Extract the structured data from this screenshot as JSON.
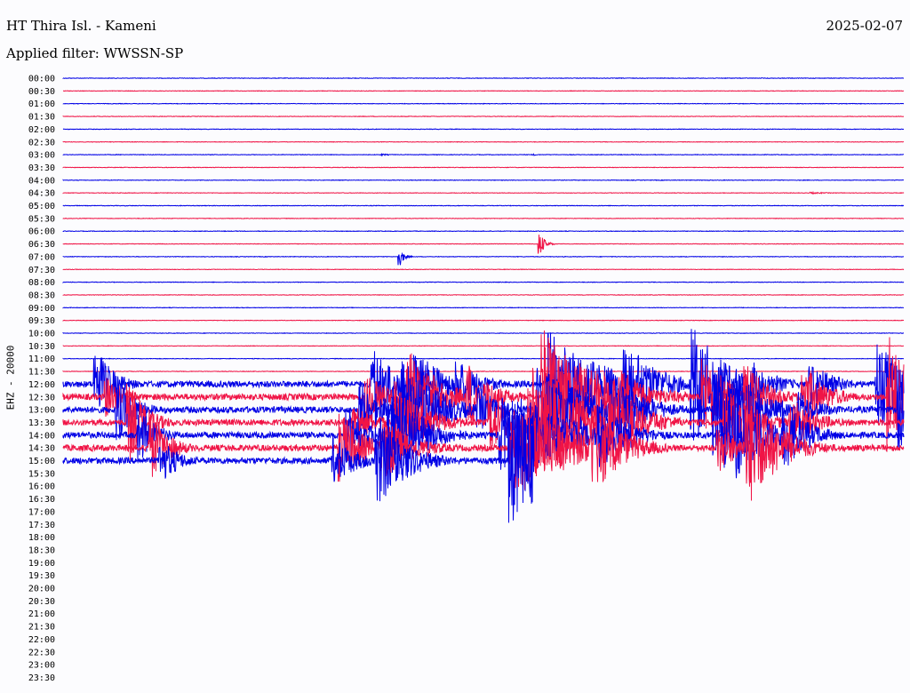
{
  "header": {
    "station": "HT Thira Isl. - Kameni",
    "date": "2025-02-07",
    "filter": "Applied filter: WWSSN-SP"
  },
  "channel_label": "EHZ - 20000",
  "colors": {
    "even_trace": "#0000e6",
    "odd_trace": "#f01446",
    "background": "#fcfcfe"
  },
  "chart_data": {
    "type": "line",
    "description_of_axes": "helicorder",
    "ylabels": [
      "00:00",
      "00:30",
      "01:00",
      "01:30",
      "02:00",
      "02:30",
      "03:00",
      "03:30",
      "04:00",
      "04:30",
      "05:00",
      "05:30",
      "06:00",
      "06:30",
      "07:00",
      "07:30",
      "08:00",
      "08:30",
      "09:00",
      "09:30",
      "10:00",
      "10:30",
      "11:00",
      "11:30",
      "12:00",
      "12:30",
      "13:00",
      "13:30",
      "14:00",
      "14:30",
      "15:00",
      "15:30",
      "16:00",
      "16:30",
      "17:00",
      "17:30",
      "18:00",
      "18:30",
      "19:00",
      "19:30",
      "20:00",
      "20:30",
      "21:00",
      "21:30",
      "22:00",
      "22:30",
      "23:00",
      "23:30"
    ],
    "last_data_row": 30,
    "last_data_fraction": 0.56,
    "events": [
      {
        "row": 6,
        "pos": 0.38,
        "amp": 1,
        "dur": 0.01
      },
      {
        "row": 6,
        "pos": 0.56,
        "amp": 1,
        "dur": 0.005
      },
      {
        "row": 9,
        "pos": 0.89,
        "amp": 1,
        "dur": 0.02
      },
      {
        "row": 13,
        "pos": 0.567,
        "amp": 14,
        "dur": 0.006
      },
      {
        "row": 14,
        "pos": 0.4,
        "amp": 12,
        "dur": 0.005
      },
      {
        "row": 24,
        "pos": 0.04,
        "amp": 45,
        "dur": 0.03
      },
      {
        "row": 24,
        "pos": 0.37,
        "amp": 40,
        "dur": 0.04
      },
      {
        "row": 24,
        "pos": 0.42,
        "amp": 70,
        "dur": 0.05
      },
      {
        "row": 24,
        "pos": 0.47,
        "amp": 45,
        "dur": 0.04
      },
      {
        "row": 24,
        "pos": 0.58,
        "amp": 75,
        "dur": 0.09
      },
      {
        "row": 24,
        "pos": 0.67,
        "amp": 60,
        "dur": 0.05
      },
      {
        "row": 24,
        "pos": 0.75,
        "amp": 70,
        "dur": 0.05
      },
      {
        "row": 24,
        "pos": 0.82,
        "amp": 50,
        "dur": 0.04
      },
      {
        "row": 24,
        "pos": 0.89,
        "amp": 40,
        "dur": 0.04
      },
      {
        "row": 24,
        "pos": 0.97,
        "amp": 70,
        "dur": 0.04
      }
    ]
  }
}
